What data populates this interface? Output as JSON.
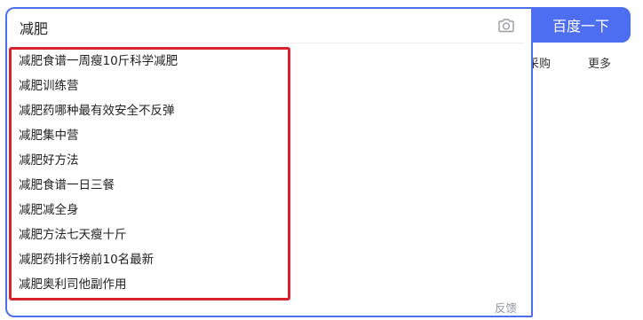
{
  "search": {
    "query": "减肥",
    "submit_label": "百度一下"
  },
  "nav": {
    "caigou_label": "采购",
    "more_label": "更多"
  },
  "suggestions": [
    "减肥食谱一周瘦10斤科学减肥",
    "减肥训练营",
    "减肥药哪种最有效安全不反弹",
    "减肥集中营",
    "减肥好方法",
    "减肥食谱一日三餐",
    "减肥减全身",
    "减肥方法七天瘦十斤",
    "减肥药排行榜前10名最新",
    "减肥奥利司他副作用"
  ],
  "feedback_label": "反馈",
  "colors": {
    "accent": "#4e6ef2",
    "highlight": "#d8232f"
  },
  "icons": {
    "camera": "camera-icon"
  }
}
